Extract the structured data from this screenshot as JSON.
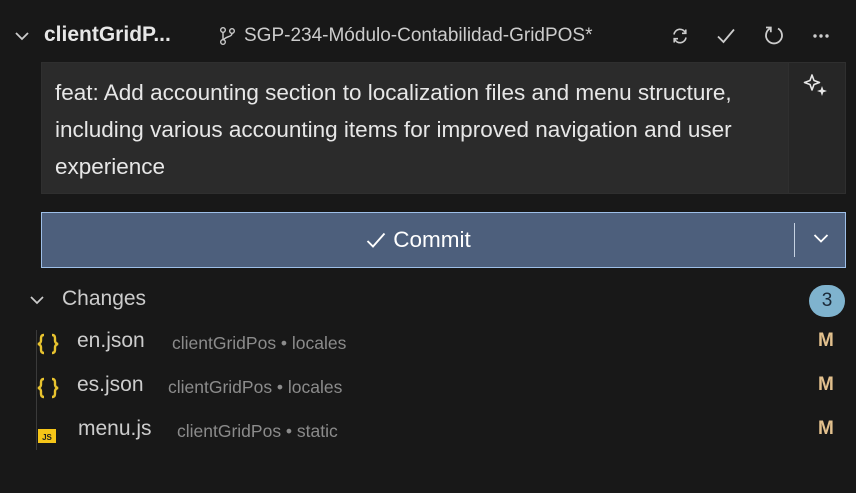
{
  "header": {
    "repo_name": "clientGridP...",
    "branch": "SGP-234-Módulo-Contabilidad-GridPOS*",
    "icons": [
      "chevron-down-icon",
      "git-branch-icon",
      "sync-icon",
      "check-icon",
      "refresh-icon",
      "more-icon"
    ]
  },
  "commit_message": {
    "value": "feat: Add accounting section to localization files and menu structure, including various accounting items for improved navigation and user experience",
    "generate_icon": "sparkle-icon"
  },
  "commit_button": {
    "label": "Commit",
    "icons": [
      "check-icon",
      "chevron-down-icon"
    ]
  },
  "changes": {
    "label": "Changes",
    "count": "3",
    "files": [
      {
        "name": "en.json",
        "description": "clientGridPos • locales",
        "status": "M",
        "icon": "json-icon"
      },
      {
        "name": "es.json",
        "description": "clientGridPos • locales",
        "status": "M",
        "icon": "json-icon"
      },
      {
        "name": "menu.js",
        "description": "clientGridPos • static",
        "status": "M",
        "icon": "js-icon"
      }
    ]
  },
  "colors": {
    "background": "#181818",
    "input_background": "#2b2b2b",
    "commit_button": "#4d5f7c",
    "commit_border": "#9ebfe8",
    "badge": "#7fb3ce",
    "json_icon": "#e8c32f",
    "js_icon": "#f5c518",
    "modified": "#e2c08d"
  }
}
